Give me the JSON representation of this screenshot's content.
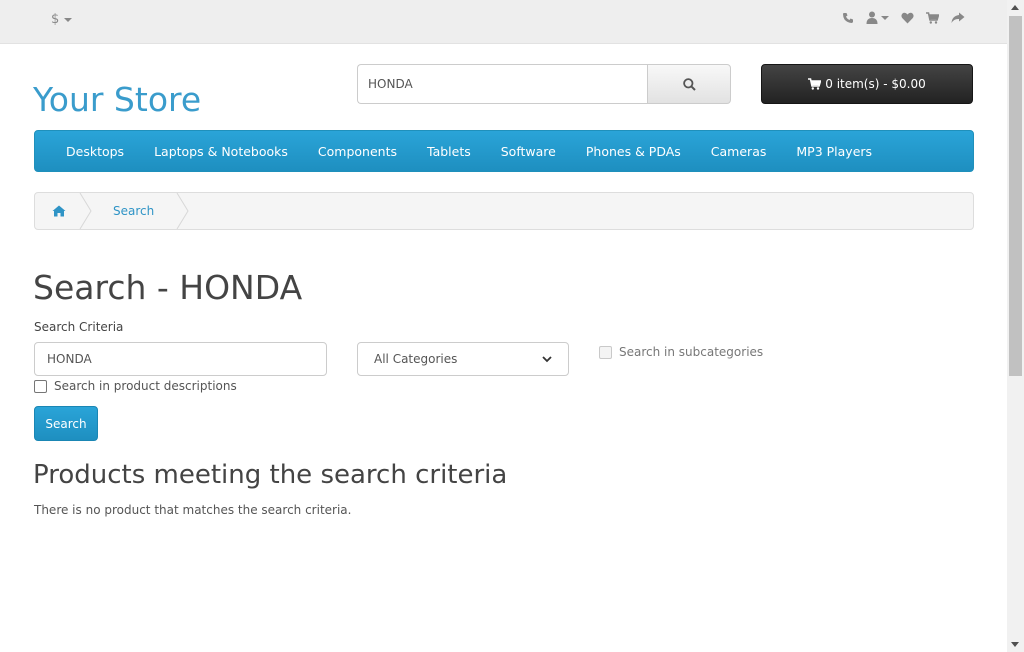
{
  "topbar": {
    "currency_label": "$",
    "icons": [
      "phone-icon",
      "user-icon",
      "heart-icon",
      "cart-icon",
      "share-icon"
    ]
  },
  "header": {
    "logo": "Your Store",
    "search_value": "HONDA",
    "cart_label": "0 item(s) - $0.00"
  },
  "menu": {
    "items": [
      "Desktops",
      "Laptops & Notebooks",
      "Components",
      "Tablets",
      "Software",
      "Phones & PDAs",
      "Cameras",
      "MP3 Players"
    ]
  },
  "breadcrumb": {
    "search_label": "Search"
  },
  "content": {
    "title": "Search - HONDA",
    "criteria_label": "Search Criteria",
    "criteria_value": "HONDA",
    "category_selected": "All Categories",
    "subcategories_label": "Search in subcategories",
    "descriptions_label": "Search in product descriptions",
    "search_button": "Search",
    "results_heading": "Products meeting the search criteria",
    "no_results": "There is no product that matches the search criteria."
  },
  "colors": {
    "brand": "#3a9ccc",
    "menu": "#229ac8",
    "cart": "#303030"
  }
}
